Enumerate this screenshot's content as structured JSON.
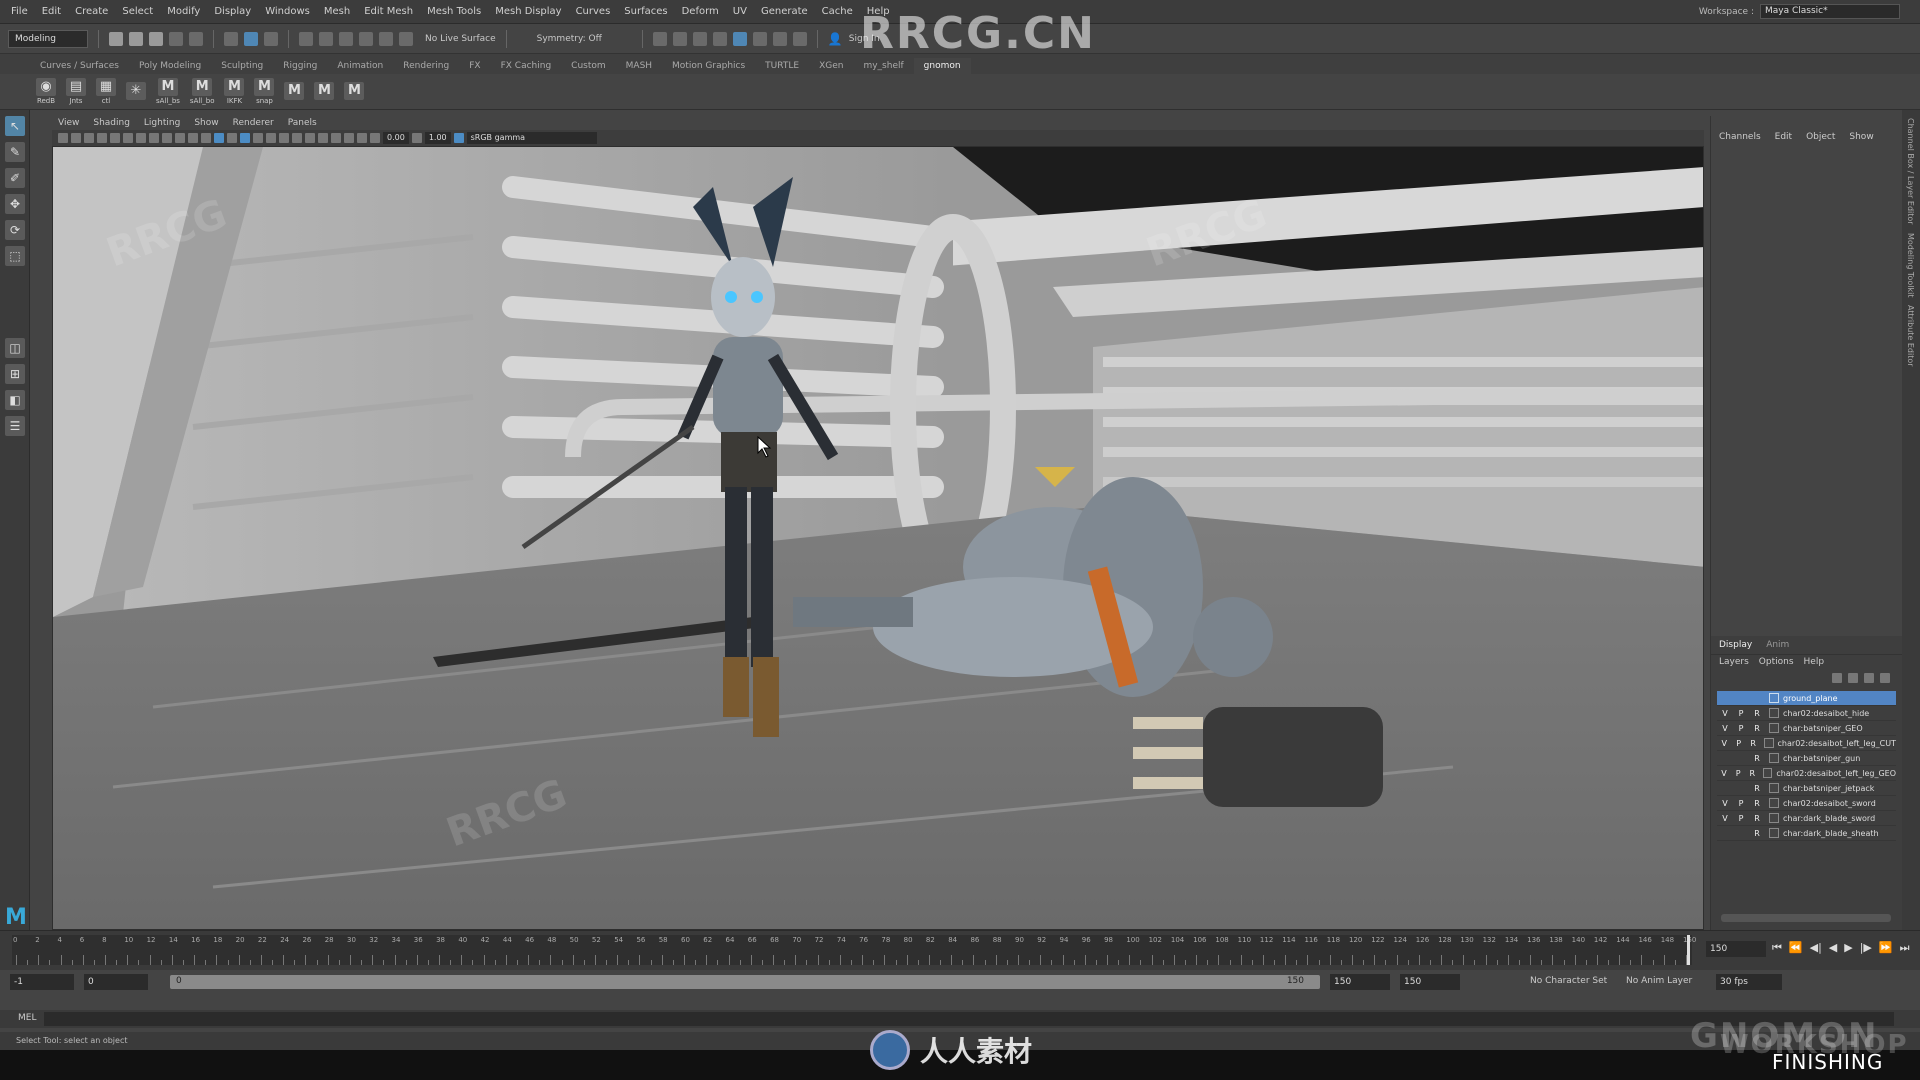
{
  "watermark": {
    "top": "RRCG.CN",
    "bottom": "人人素材",
    "corner": "FINISHING",
    "brand": "GNOMON",
    "brand_sub": "WORKSHOP"
  },
  "menubar": {
    "items": [
      "File",
      "Edit",
      "Create",
      "Select",
      "Modify",
      "Display",
      "Windows",
      "Mesh",
      "Edit Mesh",
      "Mesh Tools",
      "Mesh Display",
      "Curves",
      "Surfaces",
      "Deform",
      "UV",
      "Generate",
      "Cache",
      "Help"
    ],
    "workspace_label": "Workspace :",
    "workspace_value": "Maya Classic*"
  },
  "statusline": {
    "mode": "Modeling",
    "live_surface": "No Live Surface",
    "symmetry": "Symmetry: Off",
    "sign_in": "Sign In"
  },
  "shelf": {
    "tabs": [
      "Curves / Surfaces",
      "Poly Modeling",
      "Sculpting",
      "Rigging",
      "Animation",
      "Rendering",
      "FX",
      "FX Caching",
      "Custom",
      "MASH",
      "Motion Graphics",
      "TURTLE",
      "XGen",
      "my_shelf",
      "gnomon"
    ],
    "active_tab": "gnomon",
    "icons": [
      {
        "glyph": "◉",
        "label": "RedB"
      },
      {
        "glyph": "▤",
        "label": "Jnts"
      },
      {
        "glyph": "▦",
        "label": "ctl"
      },
      {
        "glyph": "✳",
        "label": ""
      },
      {
        "glyph": "M",
        "label": "sAll_bs"
      },
      {
        "glyph": "M",
        "label": "sAll_bo"
      },
      {
        "glyph": "M",
        "label": "IKFK"
      },
      {
        "glyph": "M",
        "label": "snap"
      },
      {
        "glyph": "M",
        "label": ""
      },
      {
        "glyph": "M",
        "label": ""
      },
      {
        "glyph": "M",
        "label": ""
      }
    ]
  },
  "viewport": {
    "menus": [
      "View",
      "Shading",
      "Lighting",
      "Show",
      "Renderer",
      "Panels"
    ],
    "exposure": "0.00",
    "gamma": "1.00",
    "color_space": "sRGB gamma"
  },
  "channelbox": {
    "menus": [
      "Channels",
      "Edit",
      "Object",
      "Show"
    ],
    "side_tabs": [
      "Channel Box / Layer Editor",
      "Modeling Toolkit",
      "Attribute Editor"
    ]
  },
  "layer_editor": {
    "tabs": [
      "Display",
      "Anim"
    ],
    "active_tab": "Display",
    "menus": [
      "Layers",
      "Options",
      "Help"
    ],
    "layers": [
      {
        "v": "",
        "p": "",
        "r": "",
        "name": "ground_plane",
        "selected": true
      },
      {
        "v": "V",
        "p": "P",
        "r": "R",
        "name": "char02:desaibot_hide",
        "selected": false
      },
      {
        "v": "V",
        "p": "P",
        "r": "R",
        "name": "char:batsniper_GEO",
        "selected": false
      },
      {
        "v": "V",
        "p": "P",
        "r": "R",
        "name": "char02:desaibot_left_leg_CUT",
        "selected": false
      },
      {
        "v": "",
        "p": "",
        "r": "R",
        "name": "char:batsniper_gun",
        "selected": false
      },
      {
        "v": "V",
        "p": "P",
        "r": "R",
        "name": "char02:desaibot_left_leg_GEO",
        "selected": false
      },
      {
        "v": "",
        "p": "",
        "r": "R",
        "name": "char:batsniper_jetpack",
        "selected": false
      },
      {
        "v": "V",
        "p": "P",
        "r": "R",
        "name": "char02:desaibot_sword",
        "selected": false
      },
      {
        "v": "V",
        "p": "P",
        "r": "R",
        "name": "char:dark_blade_sword",
        "selected": false
      },
      {
        "v": "",
        "p": "",
        "r": "R",
        "name": "char:dark_blade_sheath",
        "selected": false
      }
    ]
  },
  "timeline": {
    "current_frame": "150",
    "tick_labels": [
      "0",
      "2",
      "4",
      "6",
      "8",
      "10",
      "12",
      "14",
      "16",
      "18",
      "20",
      "22",
      "24",
      "26",
      "28",
      "30",
      "32",
      "34",
      "36",
      "38",
      "40",
      "42",
      "44",
      "46",
      "48",
      "50",
      "52",
      "54",
      "56",
      "58",
      "60",
      "62",
      "64",
      "66",
      "68",
      "70",
      "72",
      "74",
      "76",
      "78",
      "80",
      "82",
      "84",
      "86",
      "88",
      "90",
      "92",
      "94",
      "96",
      "98",
      "100",
      "102",
      "104",
      "106",
      "108",
      "110",
      "112",
      "114",
      "116",
      "118",
      "120",
      "122",
      "124",
      "126",
      "128",
      "130",
      "132",
      "134",
      "136",
      "138",
      "140",
      "142",
      "144",
      "146",
      "148",
      "150"
    ],
    "end_label": "150",
    "controls": [
      "⏮",
      "⏪",
      "◀|",
      "◀",
      "▶",
      "|▶",
      "⏩",
      "⏭"
    ]
  },
  "range": {
    "start": "-1",
    "playback_start": "0",
    "slider_start": "0",
    "slider_end": "150",
    "playback_end": "150",
    "end": "150",
    "character_set": "No Character Set",
    "anim_layer": "No Anim Layer",
    "fps": "30 fps"
  },
  "cmdline": {
    "label": "MEL",
    "help": "Select Tool: select an object"
  }
}
